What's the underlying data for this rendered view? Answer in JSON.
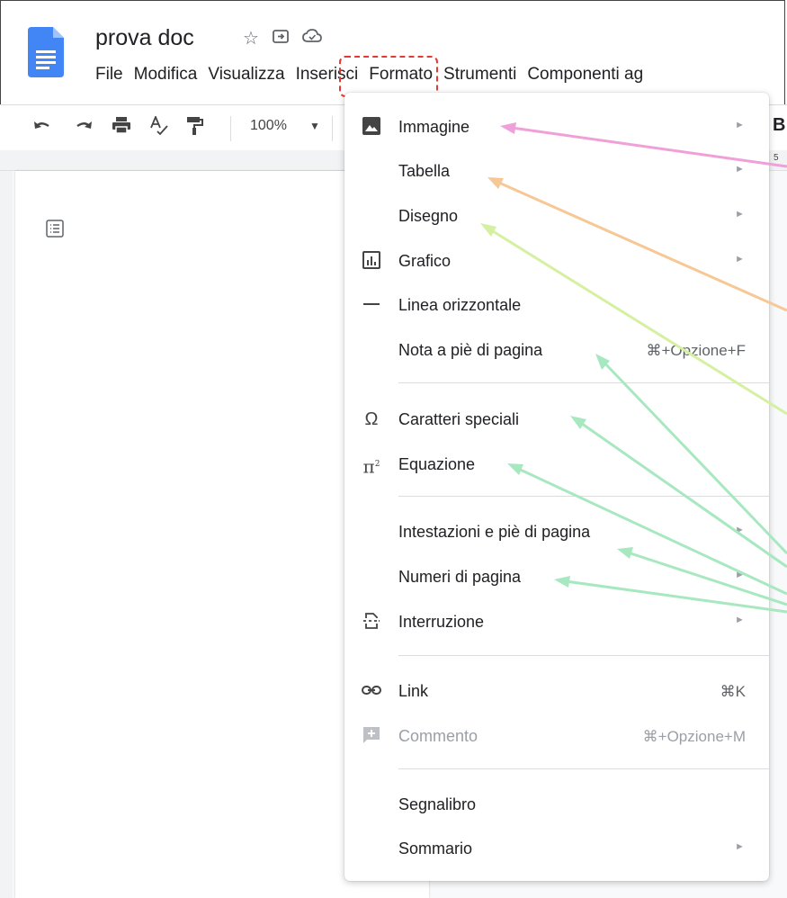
{
  "app": {
    "doc_title": "prova doc"
  },
  "menubar": {
    "items": [
      "File",
      "Modifica",
      "Visualizza",
      "Inserisci",
      "Formato",
      "Strumenti",
      "Componenti ag"
    ]
  },
  "toolbar": {
    "zoom": "100%"
  },
  "right_edge": {
    "bold_letter": "B",
    "ruler_tick": "5"
  },
  "insert_menu": {
    "items": [
      {
        "label": "Immagine",
        "icon": "image-icon",
        "arrow": "►"
      },
      {
        "label": "Tabella",
        "arrow": "►"
      },
      {
        "label": "Disegno",
        "arrow": "►"
      },
      {
        "label": "Grafico",
        "icon": "chart-icon",
        "arrow": "►"
      },
      {
        "label": "Linea orizzontale",
        "icon": "horizontal-line-icon"
      },
      {
        "label": "Nota a piè di pagina",
        "shortcut": "⌘+Opzione+F"
      },
      {
        "label": "Caratteri speciali",
        "icon": "omega-icon"
      },
      {
        "label": "Equazione",
        "icon": "pi-squared-icon"
      },
      {
        "label": "Intestazioni e piè di pagina",
        "arrow": "►"
      },
      {
        "label": "Numeri di pagina",
        "arrow": "►"
      },
      {
        "label": "Interruzione",
        "icon": "page-break-icon",
        "arrow": "►"
      },
      {
        "label": "Link",
        "icon": "link-icon",
        "shortcut": "⌘K"
      },
      {
        "label": "Commento",
        "icon": "add-comment-icon",
        "shortcut": "⌘+Opzione+M",
        "disabled": true
      },
      {
        "label": "Segnalibro"
      },
      {
        "label": "Sommario",
        "arrow": "►"
      }
    ]
  },
  "annotation_colors": {
    "pink": "#f0a0d8",
    "orange": "#f5c896",
    "lime": "#d4f0a0",
    "mint": "#a8e8c0",
    "highlight_box": "#e53935"
  }
}
